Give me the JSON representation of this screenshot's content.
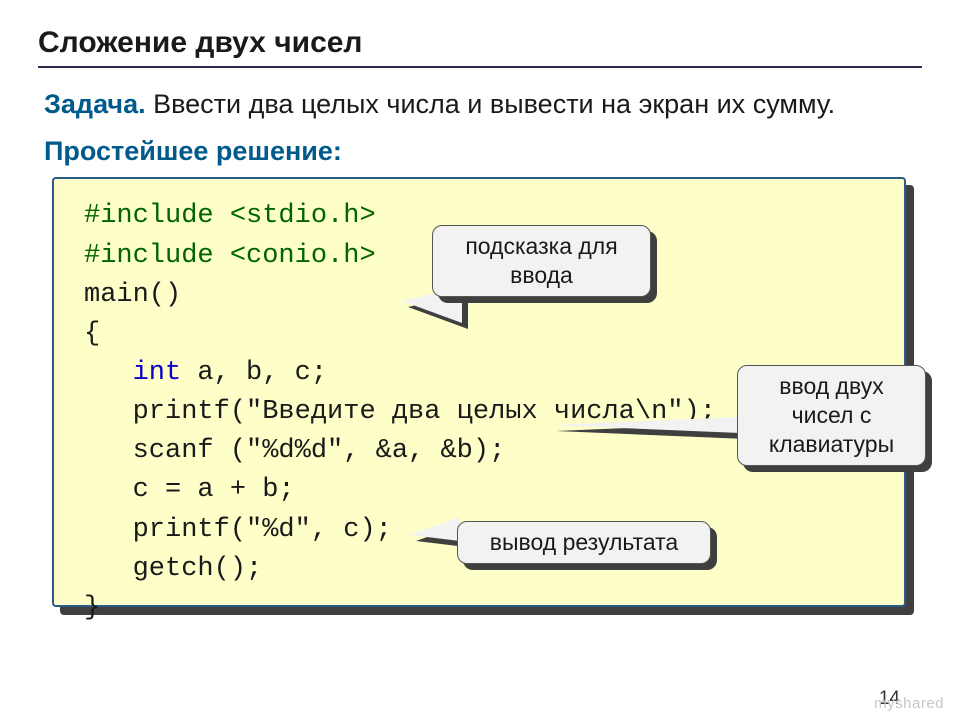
{
  "title": "Сложение двух чисел",
  "task_label": "Задача.",
  "task_text": " Ввести два целых числа и вывести на экран их сумму.",
  "subheading": "Простейшее решение:",
  "code": {
    "l1a": "#include ",
    "l1b": "<stdio.h>",
    "l2a": "#include ",
    "l2b": "<conio.h>",
    "l3": "main()",
    "l4": "{",
    "l5a": "   ",
    "l5b": "int",
    "l5c": " a, b, c;",
    "l6": "   printf(\"Введите два целых числа\\n\");",
    "l7": "   scanf (\"%d%d\", &a, &b);",
    "l8": "   c = a + b;",
    "l9": "   printf(\"%d\", c);",
    "l10": "   getch();",
    "l11": "}"
  },
  "callouts": {
    "hint": "подсказка для\nввода",
    "input": "ввод двух\nчисел с\nклавиатуры",
    "output": "вывод результата"
  },
  "pagenum": "14",
  "watermark": "myshared"
}
